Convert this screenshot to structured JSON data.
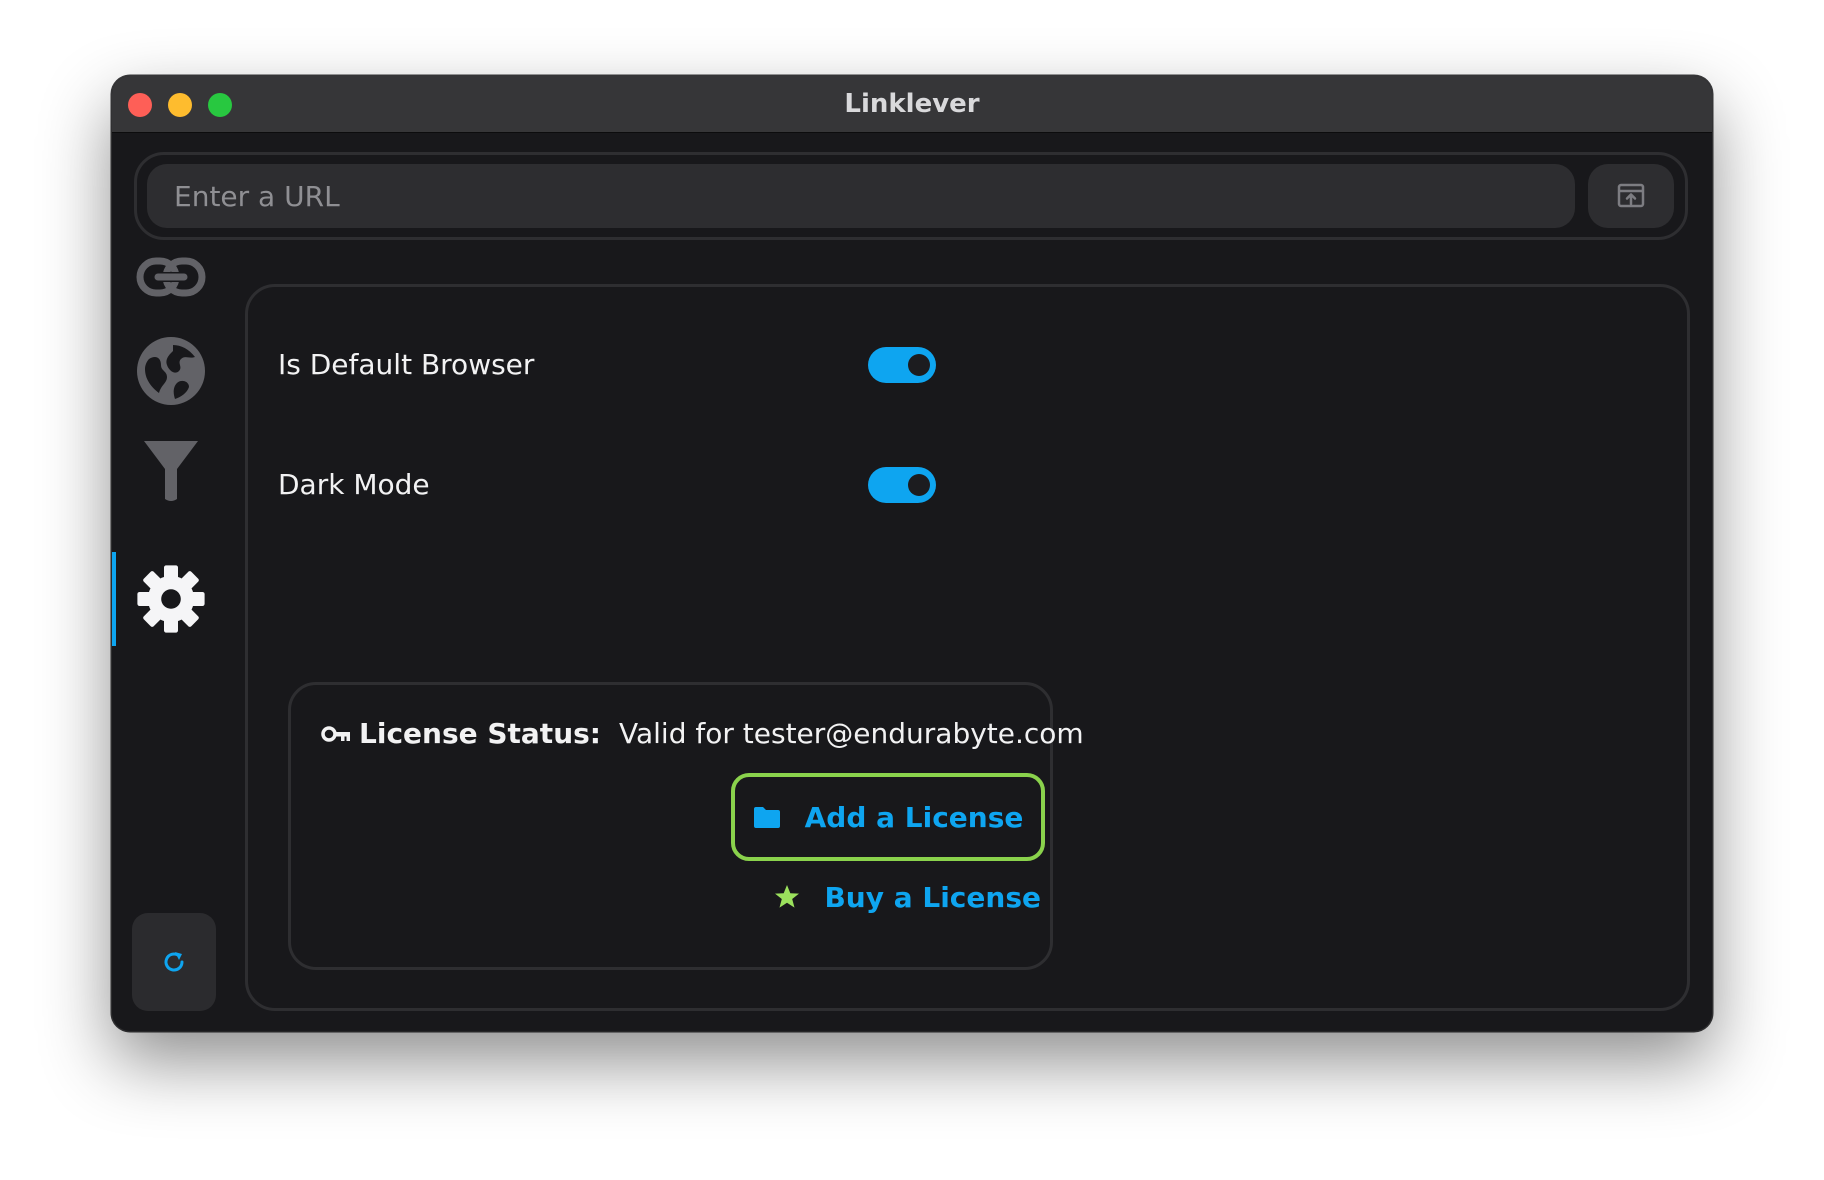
{
  "window": {
    "title": "Linklever"
  },
  "url_bar": {
    "placeholder": "Enter a URL",
    "value": ""
  },
  "sidebar": {
    "items": [
      {
        "icon": "link-icon",
        "active": false
      },
      {
        "icon": "globe-icon",
        "active": false
      },
      {
        "icon": "filter-icon",
        "active": false
      },
      {
        "icon": "gear-icon",
        "active": true
      }
    ],
    "refresh_icon": "refresh-icon"
  },
  "settings": {
    "default_browser": {
      "label": "Is Default Browser",
      "enabled": true
    },
    "dark_mode": {
      "label": "Dark Mode",
      "enabled": true
    }
  },
  "license": {
    "status_label": "License Status:",
    "status_value": "Valid for tester@endurabyte.com",
    "add_label": "Add a License",
    "buy_label": "Buy a License"
  },
  "colors": {
    "accent": "#0ea5f0",
    "focus_ring": "#8ad24c",
    "star": "#9be15d",
    "background": "#18181b",
    "titlebar": "#363638"
  }
}
